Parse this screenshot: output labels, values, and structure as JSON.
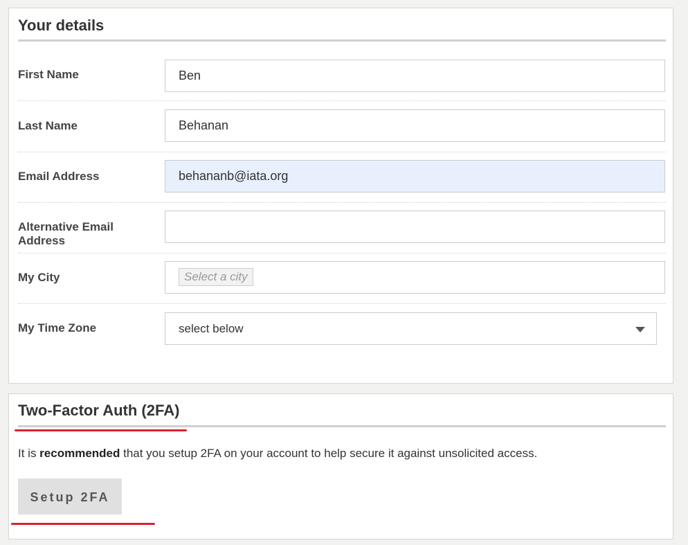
{
  "details": {
    "title": "Your details",
    "fields": {
      "first_name": {
        "label": "First Name",
        "value": "Ben"
      },
      "last_name": {
        "label": "Last Name",
        "value": "Behanan"
      },
      "email": {
        "label": "Email Address",
        "value": "behananb@iata.org"
      },
      "alt_email": {
        "label": "Alternative Email Address",
        "value": ""
      },
      "city": {
        "label": "My City",
        "placeholder": "Select a city"
      },
      "timezone": {
        "label": "My Time Zone",
        "selected": "select below"
      }
    }
  },
  "twofa": {
    "title": "Two-Factor Auth (2FA)",
    "text_before": "It is ",
    "text_bold": "recommended",
    "text_after": " that you setup 2FA on your account to help secure it against unsolicited access.",
    "button_label": "Setup 2FA"
  },
  "colors": {
    "autofill_bg": "#e8f0fe",
    "annotation_red": "#d9232e"
  }
}
